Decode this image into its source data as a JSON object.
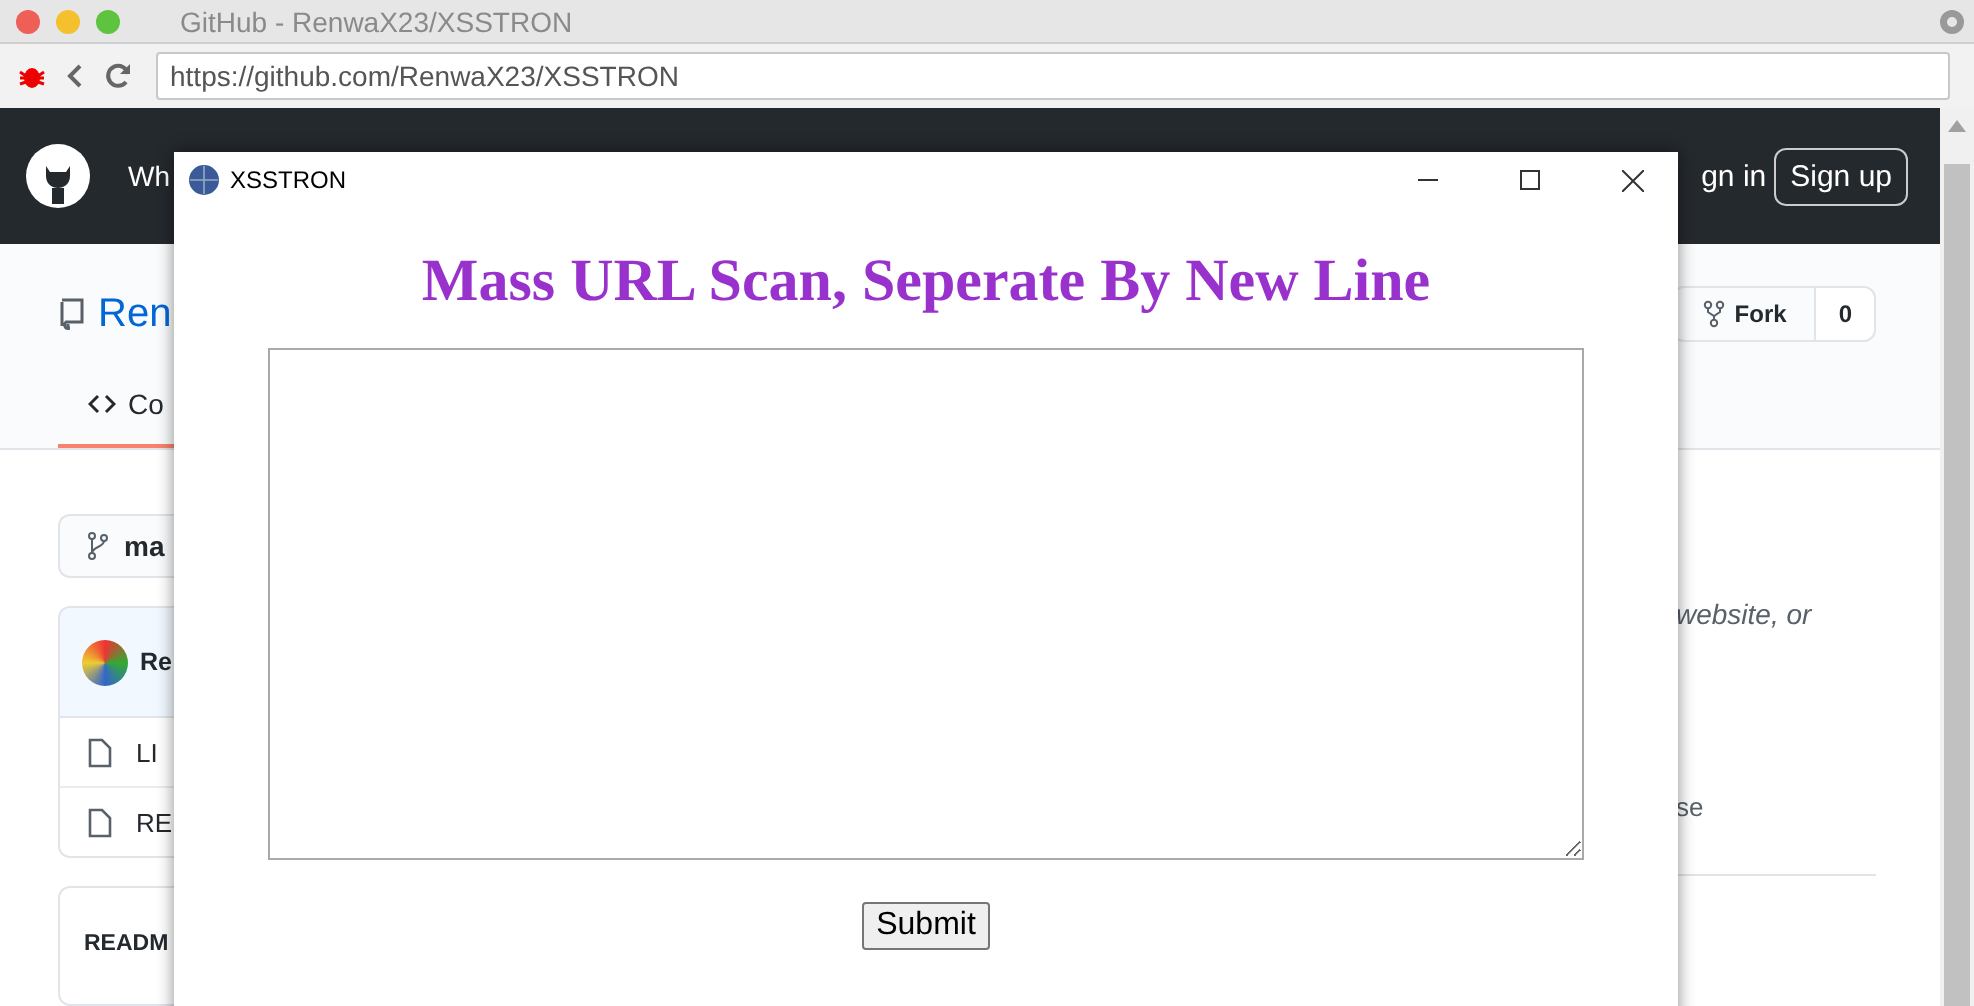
{
  "browser": {
    "title": "GitHub - RenwaX23/XSSTRON",
    "url": "https://github.com/RenwaX23/XSSTRON"
  },
  "github": {
    "nav_text": "Wh",
    "sign_in": "gn in",
    "sign_up": "Sign up",
    "repo_name": "Ren",
    "fork": {
      "label": "Fork",
      "count": "0"
    },
    "tabs": [
      {
        "label": "Co",
        "selected": true
      }
    ],
    "branch": "ma",
    "commit_author": "Re",
    "files": [
      "LI",
      "RE"
    ],
    "readme_title": "READM",
    "about_text": "website, or",
    "about_line": "se"
  },
  "dialog": {
    "title": "XSSTRON",
    "heading": "Mass URL Scan, Seperate By New Line",
    "submit": "Submit"
  }
}
